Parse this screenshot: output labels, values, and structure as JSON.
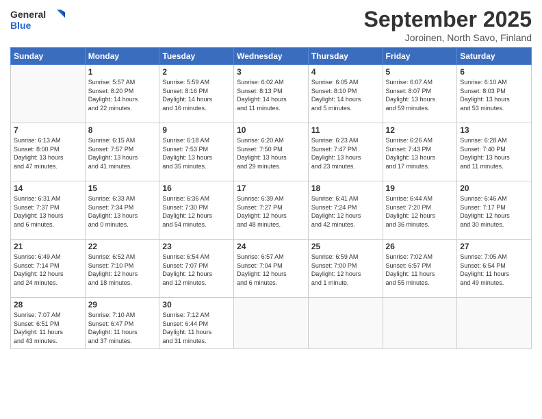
{
  "logo": {
    "line1": "General",
    "line2": "Blue"
  },
  "title": "September 2025",
  "location": "Joroinen, North Savo, Finland",
  "days_of_week": [
    "Sunday",
    "Monday",
    "Tuesday",
    "Wednesday",
    "Thursday",
    "Friday",
    "Saturday"
  ],
  "weeks": [
    [
      {
        "day": "",
        "info": ""
      },
      {
        "day": "1",
        "info": "Sunrise: 5:57 AM\nSunset: 8:20 PM\nDaylight: 14 hours\nand 22 minutes."
      },
      {
        "day": "2",
        "info": "Sunrise: 5:59 AM\nSunset: 8:16 PM\nDaylight: 14 hours\nand 16 minutes."
      },
      {
        "day": "3",
        "info": "Sunrise: 6:02 AM\nSunset: 8:13 PM\nDaylight: 14 hours\nand 11 minutes."
      },
      {
        "day": "4",
        "info": "Sunrise: 6:05 AM\nSunset: 8:10 PM\nDaylight: 14 hours\nand 5 minutes."
      },
      {
        "day": "5",
        "info": "Sunrise: 6:07 AM\nSunset: 8:07 PM\nDaylight: 13 hours\nand 59 minutes."
      },
      {
        "day": "6",
        "info": "Sunrise: 6:10 AM\nSunset: 8:03 PM\nDaylight: 13 hours\nand 53 minutes."
      }
    ],
    [
      {
        "day": "7",
        "info": "Sunrise: 6:13 AM\nSunset: 8:00 PM\nDaylight: 13 hours\nand 47 minutes."
      },
      {
        "day": "8",
        "info": "Sunrise: 6:15 AM\nSunset: 7:57 PM\nDaylight: 13 hours\nand 41 minutes."
      },
      {
        "day": "9",
        "info": "Sunrise: 6:18 AM\nSunset: 7:53 PM\nDaylight: 13 hours\nand 35 minutes."
      },
      {
        "day": "10",
        "info": "Sunrise: 6:20 AM\nSunset: 7:50 PM\nDaylight: 13 hours\nand 29 minutes."
      },
      {
        "day": "11",
        "info": "Sunrise: 6:23 AM\nSunset: 7:47 PM\nDaylight: 13 hours\nand 23 minutes."
      },
      {
        "day": "12",
        "info": "Sunrise: 6:26 AM\nSunset: 7:43 PM\nDaylight: 13 hours\nand 17 minutes."
      },
      {
        "day": "13",
        "info": "Sunrise: 6:28 AM\nSunset: 7:40 PM\nDaylight: 13 hours\nand 11 minutes."
      }
    ],
    [
      {
        "day": "14",
        "info": "Sunrise: 6:31 AM\nSunset: 7:37 PM\nDaylight: 13 hours\nand 6 minutes."
      },
      {
        "day": "15",
        "info": "Sunrise: 6:33 AM\nSunset: 7:34 PM\nDaylight: 13 hours\nand 0 minutes."
      },
      {
        "day": "16",
        "info": "Sunrise: 6:36 AM\nSunset: 7:30 PM\nDaylight: 12 hours\nand 54 minutes."
      },
      {
        "day": "17",
        "info": "Sunrise: 6:39 AM\nSunset: 7:27 PM\nDaylight: 12 hours\nand 48 minutes."
      },
      {
        "day": "18",
        "info": "Sunrise: 6:41 AM\nSunset: 7:24 PM\nDaylight: 12 hours\nand 42 minutes."
      },
      {
        "day": "19",
        "info": "Sunrise: 6:44 AM\nSunset: 7:20 PM\nDaylight: 12 hours\nand 36 minutes."
      },
      {
        "day": "20",
        "info": "Sunrise: 6:46 AM\nSunset: 7:17 PM\nDaylight: 12 hours\nand 30 minutes."
      }
    ],
    [
      {
        "day": "21",
        "info": "Sunrise: 6:49 AM\nSunset: 7:14 PM\nDaylight: 12 hours\nand 24 minutes."
      },
      {
        "day": "22",
        "info": "Sunrise: 6:52 AM\nSunset: 7:10 PM\nDaylight: 12 hours\nand 18 minutes."
      },
      {
        "day": "23",
        "info": "Sunrise: 6:54 AM\nSunset: 7:07 PM\nDaylight: 12 hours\nand 12 minutes."
      },
      {
        "day": "24",
        "info": "Sunrise: 6:57 AM\nSunset: 7:04 PM\nDaylight: 12 hours\nand 6 minutes."
      },
      {
        "day": "25",
        "info": "Sunrise: 6:59 AM\nSunset: 7:00 PM\nDaylight: 12 hours\nand 1 minute."
      },
      {
        "day": "26",
        "info": "Sunrise: 7:02 AM\nSunset: 6:57 PM\nDaylight: 11 hours\nand 55 minutes."
      },
      {
        "day": "27",
        "info": "Sunrise: 7:05 AM\nSunset: 6:54 PM\nDaylight: 11 hours\nand 49 minutes."
      }
    ],
    [
      {
        "day": "28",
        "info": "Sunrise: 7:07 AM\nSunset: 6:51 PM\nDaylight: 11 hours\nand 43 minutes."
      },
      {
        "day": "29",
        "info": "Sunrise: 7:10 AM\nSunset: 6:47 PM\nDaylight: 11 hours\nand 37 minutes."
      },
      {
        "day": "30",
        "info": "Sunrise: 7:12 AM\nSunset: 6:44 PM\nDaylight: 11 hours\nand 31 minutes."
      },
      {
        "day": "",
        "info": ""
      },
      {
        "day": "",
        "info": ""
      },
      {
        "day": "",
        "info": ""
      },
      {
        "day": "",
        "info": ""
      }
    ]
  ]
}
